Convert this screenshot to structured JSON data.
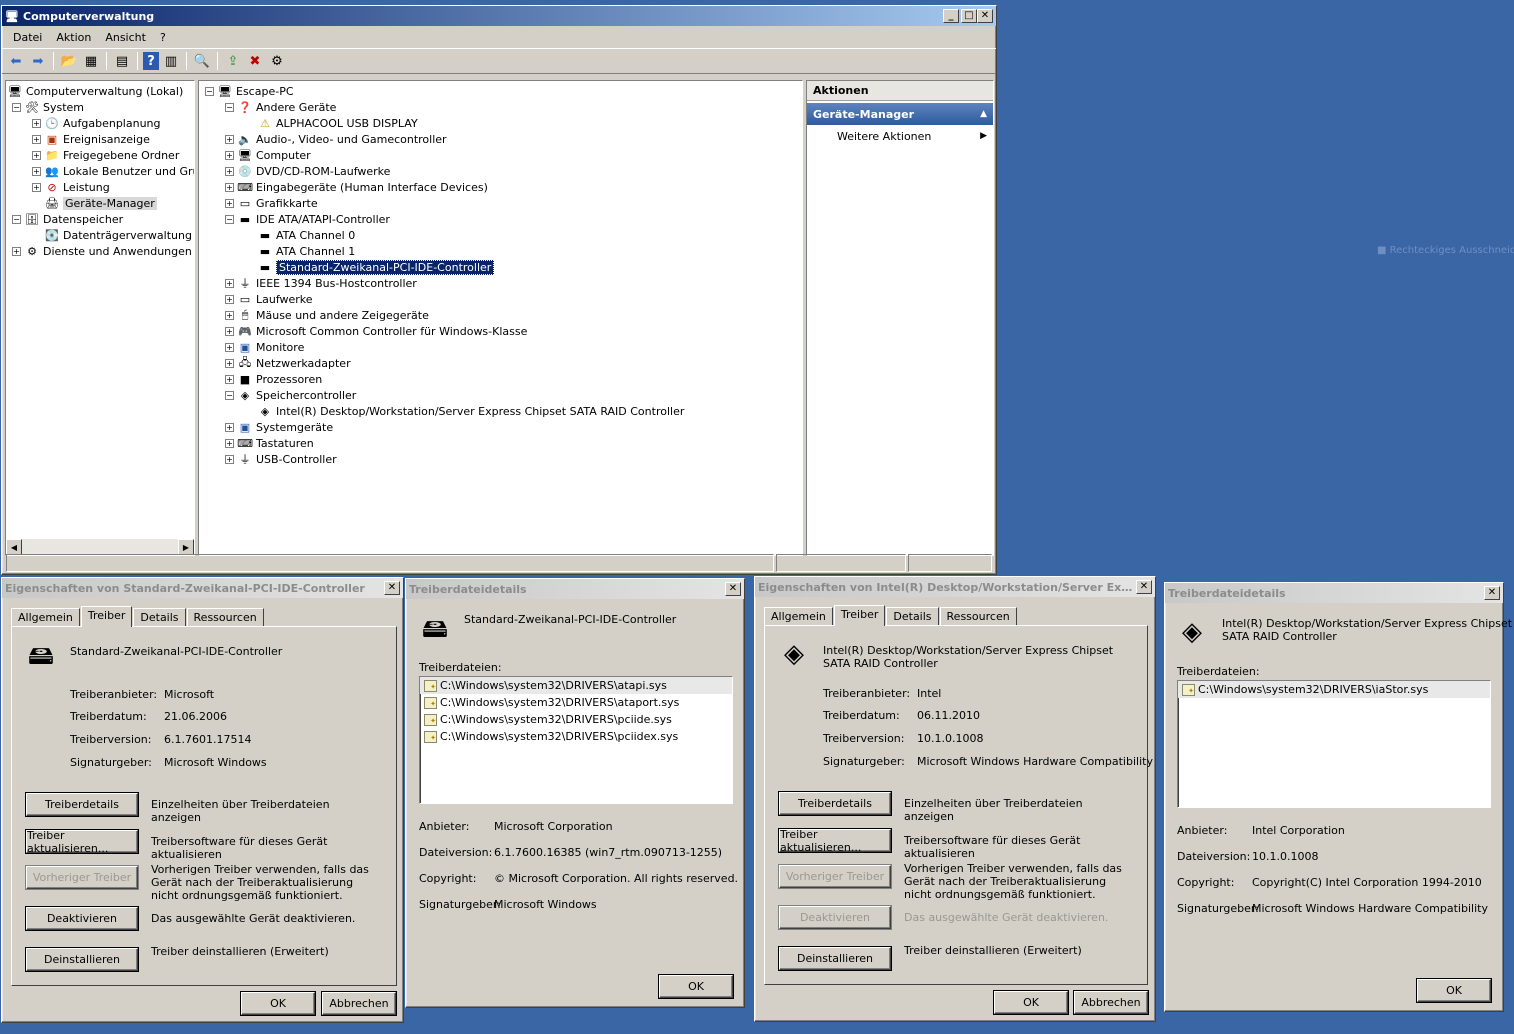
{
  "main": {
    "title": "Computerverwaltung",
    "menu": [
      "Datei",
      "Aktion",
      "Ansicht",
      "?"
    ],
    "left_tree": {
      "root": "Computerverwaltung (Lokal)",
      "system": "System",
      "aufgabenplanung": "Aufgabenplanung",
      "ereignisanzeige": "Ereignisanzeige",
      "freigegebene": "Freigegebene Ordner",
      "lokale": "Lokale Benutzer und Grupp",
      "leistung": "Leistung",
      "geraete": "Geräte-Manager",
      "datenspeicher": "Datenspeicher",
      "datentraeger": "Datenträgerverwaltung",
      "dienste": "Dienste und Anwendungen"
    },
    "device_tree": {
      "root": "Escape-PC",
      "andere": "Andere Geräte",
      "alphacool": "ALPHACOOL USB DISPLAY",
      "audio": "Audio-, Video- und Gamecontroller",
      "computer": "Computer",
      "dvd": "DVD/CD-ROM-Laufwerke",
      "eingabe": "Eingabegeräte (Human Interface Devices)",
      "grafik": "Grafikkarte",
      "ide": "IDE ATA/ATAPI-Controller",
      "ata0": "ATA Channel 0",
      "ata1": "ATA Channel 1",
      "stdide": "Standard-Zweikanal-PCI-IDE-Controller",
      "ieee": "IEEE 1394 Bus-Hostcontroller",
      "laufwerke": "Laufwerke",
      "maeuse": "Mäuse und andere Zeigegeräte",
      "mscommon": "Microsoft Common Controller für Windows-Klasse",
      "monitore": "Monitore",
      "netzwerk": "Netzwerkadapter",
      "prozessoren": "Prozessoren",
      "speicher": "Speichercontroller",
      "intelraid": "Intel(R) Desktop/Workstation/Server Express Chipset SATA RAID Controller",
      "system": "Systemgeräte",
      "tastaturen": "Tastaturen",
      "usb": "USB-Controller"
    },
    "actions": {
      "header": "Aktionen",
      "section": "Geräte-Manager",
      "more": "Weitere Aktionen"
    }
  },
  "ghost_text": "Rechteckiges Ausschneid",
  "props1": {
    "title": "Eigenschaften von Standard-Zweikanal-PCI-IDE-Controller",
    "tabs": [
      "Allgemein",
      "Treiber",
      "Details",
      "Ressourcen"
    ],
    "device": "Standard-Zweikanal-PCI-IDE-Controller",
    "anbieter_label": "Treiberanbieter:",
    "anbieter": "Microsoft",
    "datum_label": "Treiberdatum:",
    "datum": "21.06.2006",
    "version_label": "Treiberversion:",
    "version": "6.1.7601.17514",
    "sig_label": "Signaturgeber:",
    "sig": "Microsoft Windows",
    "buttons": {
      "details": "Treiberdetails",
      "details_desc": "Einzelheiten über Treiberdateien anzeigen",
      "update": "Treiber aktualisieren...",
      "update_desc": "Treibersoftware für dieses Gerät aktualisieren",
      "rollback": "Vorheriger Treiber",
      "rollback_desc": "Vorherigen Treiber verwenden, falls das Gerät nach der Treiberaktualisierung nicht ordnungsgemäß funktioniert.",
      "disable": "Deaktivieren",
      "disable_desc": "Das ausgewählte Gerät deaktivieren.",
      "uninstall": "Deinstallieren",
      "uninstall_desc": "Treiber deinstallieren (Erweitert)"
    },
    "ok": "OK",
    "cancel": "Abbrechen"
  },
  "details1": {
    "title": "Treiberdateidetails",
    "device": "Standard-Zweikanal-PCI-IDE-Controller",
    "files_label": "Treiberdateien:",
    "files": [
      "C:\\Windows\\system32\\DRIVERS\\atapi.sys",
      "C:\\Windows\\system32\\DRIVERS\\ataport.sys",
      "C:\\Windows\\system32\\DRIVERS\\pciide.sys",
      "C:\\Windows\\system32\\DRIVERS\\pciidex.sys"
    ],
    "anbieter_label": "Anbieter:",
    "anbieter": "Microsoft Corporation",
    "dv_label": "Dateiversion:",
    "dv": "6.1.7600.16385 (win7_rtm.090713-1255)",
    "copy_label": "Copyright:",
    "copy": "© Microsoft Corporation. All rights reserved.",
    "sig_label": "Signaturgeber:",
    "sig": "Microsoft Windows",
    "ok": "OK"
  },
  "props2": {
    "title": "Eigenschaften von Intel(R) Desktop/Workstation/Server Expres...",
    "tabs": [
      "Allgemein",
      "Treiber",
      "Details",
      "Ressourcen"
    ],
    "device_line1": "Intel(R) Desktop/Workstation/Server Express Chipset",
    "device_line2": "SATA RAID Controller",
    "anbieter_label": "Treiberanbieter:",
    "anbieter": "Intel",
    "datum_label": "Treiberdatum:",
    "datum": "06.11.2010",
    "version_label": "Treiberversion:",
    "version": "10.1.0.1008",
    "sig_label": "Signaturgeber:",
    "sig": "Microsoft Windows Hardware Compatibility",
    "buttons": {
      "details": "Treiberdetails",
      "details_desc": "Einzelheiten über Treiberdateien anzeigen",
      "update": "Treiber aktualisieren...",
      "update_desc": "Treibersoftware für dieses Gerät aktualisieren",
      "rollback": "Vorheriger Treiber",
      "rollback_desc": "Vorherigen Treiber verwenden, falls das Gerät nach der Treiberaktualisierung nicht ordnungsgemäß funktioniert.",
      "disable": "Deaktivieren",
      "disable_desc": "Das ausgewählte Gerät deaktivieren.",
      "uninstall": "Deinstallieren",
      "uninstall_desc": "Treiber deinstallieren (Erweitert)"
    },
    "ok": "OK",
    "cancel": "Abbrechen"
  },
  "details2": {
    "title": "Treiberdateidetails",
    "device_line1": "Intel(R) Desktop/Workstation/Server Express Chipset",
    "device_line2": "SATA RAID Controller",
    "files_label": "Treiberdateien:",
    "files": [
      "C:\\Windows\\system32\\DRIVERS\\iaStor.sys"
    ],
    "anbieter_label": "Anbieter:",
    "anbieter": "Intel Corporation",
    "dv_label": "Dateiversion:",
    "dv": "10.1.0.1008",
    "copy_label": "Copyright:",
    "copy": "Copyright(C) Intel Corporation 1994-2010",
    "sig_label": "Signaturgeber:",
    "sig": "Microsoft Windows Hardware Compatibility",
    "ok": "OK"
  }
}
